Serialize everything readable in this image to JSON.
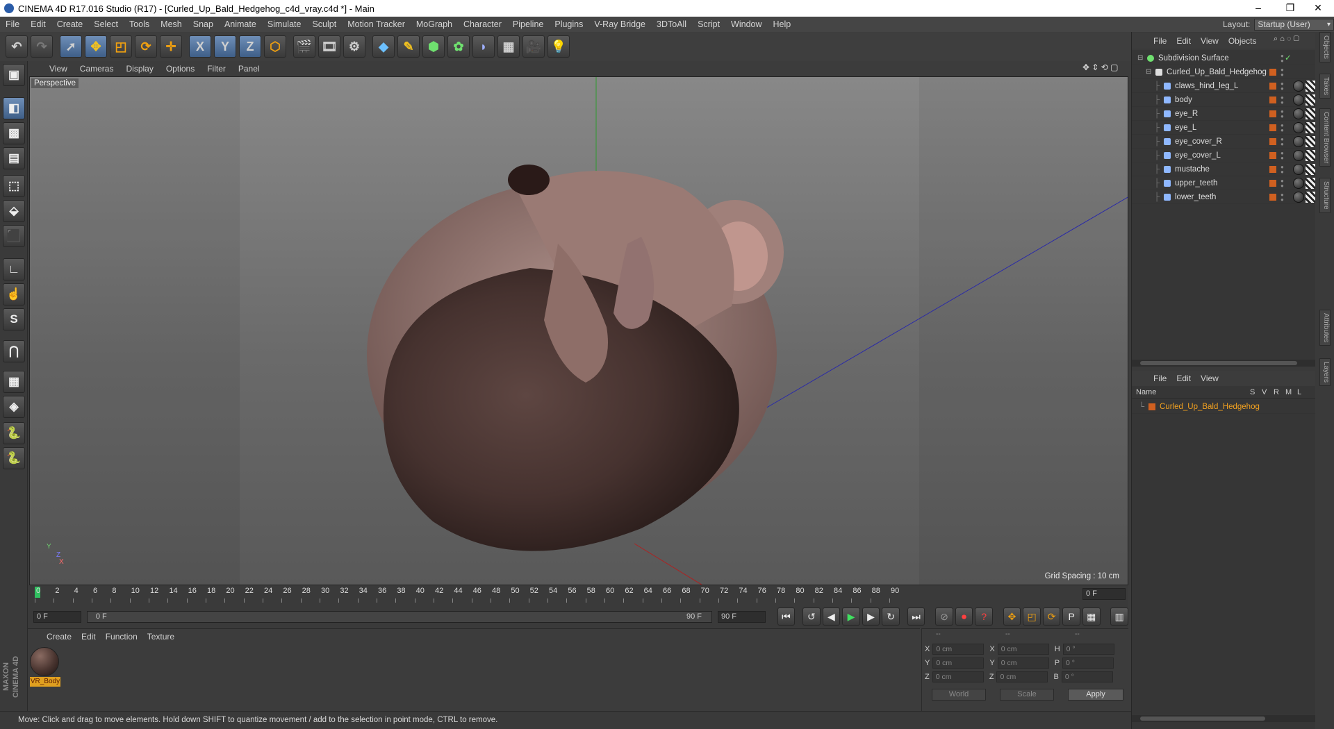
{
  "window": {
    "title": "CINEMA 4D R17.016 Studio (R17) - [Curled_Up_Bald_Hedgehog_c4d_vray.c4d *] - Main",
    "minimize": "–",
    "restore": "❐",
    "close": "✕"
  },
  "menu": [
    "File",
    "Edit",
    "Create",
    "Select",
    "Tools",
    "Mesh",
    "Snap",
    "Animate",
    "Simulate",
    "Sculpt",
    "Motion Tracker",
    "MoGraph",
    "Character",
    "Pipeline",
    "Plugins",
    "V-Ray Bridge",
    "3DToAll",
    "Script",
    "Window",
    "Help"
  ],
  "layout": {
    "label": "Layout:",
    "value": "Startup (User)"
  },
  "toolbar": {
    "x": "X",
    "y": "Y",
    "z": "Z"
  },
  "left_toolbar": {
    "s_label": "S"
  },
  "viewport": {
    "menu": [
      "View",
      "Cameras",
      "Display",
      "Options",
      "Filter",
      "Panel"
    ],
    "label": "Perspective",
    "grid_spacing": "Grid Spacing : 10 cm",
    "axis_y": "Y",
    "axis_z": "Z",
    "axis_x": "X"
  },
  "timeline": {
    "ticks": [
      "0",
      "2",
      "4",
      "6",
      "8",
      "10",
      "12",
      "14",
      "16",
      "18",
      "20",
      "22",
      "24",
      "26",
      "28",
      "30",
      "32",
      "34",
      "36",
      "38",
      "40",
      "42",
      "44",
      "46",
      "48",
      "50",
      "52",
      "54",
      "56",
      "58",
      "60",
      "62",
      "64",
      "66",
      "68",
      "70",
      "72",
      "74",
      "76",
      "78",
      "80",
      "82",
      "84",
      "86",
      "88",
      "90"
    ],
    "current": "0 F"
  },
  "transport": {
    "start": "0 F",
    "range_start": "0 F",
    "range_end": "90 F",
    "end": "90 F"
  },
  "material": {
    "menu": [
      "Create",
      "Edit",
      "Function",
      "Texture"
    ],
    "name": "VR_Body"
  },
  "coords": {
    "headers": [
      "--",
      "--",
      "--"
    ],
    "rows": [
      {
        "a": "X",
        "av": "0 cm",
        "b": "X",
        "bv": "0 cm",
        "c": "H",
        "cv": "0 °"
      },
      {
        "a": "Y",
        "av": "0 cm",
        "b": "Y",
        "bv": "0 cm",
        "c": "P",
        "cv": "0 °"
      },
      {
        "a": "Z",
        "av": "0 cm",
        "b": "Z",
        "bv": "0 cm",
        "c": "B",
        "cv": "0 °"
      }
    ],
    "world": "World",
    "scale": "Scale",
    "apply": "Apply"
  },
  "status": "Move: Click and drag to move elements. Hold down SHIFT to quantize movement / add to the selection in point mode, CTRL to remove.",
  "objects": {
    "menu": [
      "File",
      "Edit",
      "View",
      "Objects"
    ],
    "items": [
      {
        "name": "Subdivision Surface",
        "level": 0
      },
      {
        "name": "Curled_Up_Bald_Hedgehog",
        "level": 1
      },
      {
        "name": "claws_hind_leg_L",
        "level": 2
      },
      {
        "name": "body",
        "level": 2
      },
      {
        "name": "eye_R",
        "level": 2
      },
      {
        "name": "eye_L",
        "level": 2
      },
      {
        "name": "eye_cover_R",
        "level": 2
      },
      {
        "name": "eye_cover_L",
        "level": 2
      },
      {
        "name": "mustache",
        "level": 2
      },
      {
        "name": "upper_teeth",
        "level": 2
      },
      {
        "name": "lower_teeth",
        "level": 2
      }
    ]
  },
  "layers": {
    "menu": [
      "File",
      "Edit",
      "View"
    ],
    "columns": [
      "Name",
      "S",
      "V",
      "R",
      "M",
      "L"
    ],
    "item": "Curled_Up_Bald_Hedgehog"
  },
  "side_tabs": [
    "Objects",
    "Takes",
    "Content Browser",
    "Structure",
    "Attributes",
    "Layers"
  ]
}
